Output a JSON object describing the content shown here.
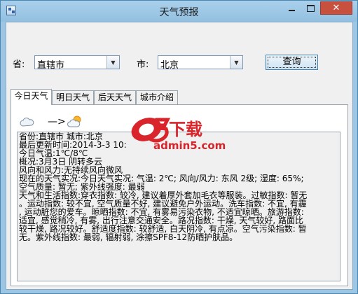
{
  "window": {
    "title": "天气预报"
  },
  "form": {
    "province_label": "省:",
    "province_value": "直辖市",
    "city_label": "市:",
    "city_value": "北京",
    "query_button": "查询"
  },
  "tabs": [
    {
      "label": "今日天气",
      "active": true
    },
    {
      "label": "明日天气",
      "active": false
    },
    {
      "label": "后天天气",
      "active": false
    },
    {
      "label": "城市介绍",
      "active": false
    }
  ],
  "weather": {
    "icon_from": "cloudy-icon",
    "arrow": "—>",
    "icon_to": "partly-cloudy-icon"
  },
  "details": [
    "省份:直辖市  城市:北京",
    "最后更新时间:2014-3-3 10:",
    "今日气温:1℃/8℃",
    "概况:3月3日 阴转多云",
    "风向和风力:无持续风向微风",
    "现在的天气实况:今日天气实况: 气温: 2℃; 风向/风力: 东风 2级; 湿度: 65%;",
    "空气质量: 暂无; 紫外线强度: 最弱",
    "天气和生活指数:穿衣指数: 较冷, 建议着厚外套加毛衣等服装。过敏指数: 暂无",
    "。运动指数: 较不宜, 空气质量不好, 建议避免户外运动。洗车指数: 不宜, 有霾",
    ", 运动脏您的爱车。晾晒指数: 不宜, 有雾易污染衣物, 不适宜晾晒。旅游指数:",
    "适宜, 感觉稍冷, 有雾, 出行注意交通安全。路况指数: 干燥, 天气较好, 路面比",
    "较干燥, 路况较好。舒适度指数: 较舒适, 白天阴冷, 有点凉。空气污染指数: 暂",
    "无。紫外线指数: 最弱, 辐射弱, 涂擦SPF8-12防晒护肤品。"
  ],
  "watermark": {
    "logo_text": "a5下载",
    "url": "admin5.com"
  },
  "colors": {
    "accent": "#3c7fb1",
    "close": "#c7503f",
    "logo_red": "#d8242a"
  }
}
